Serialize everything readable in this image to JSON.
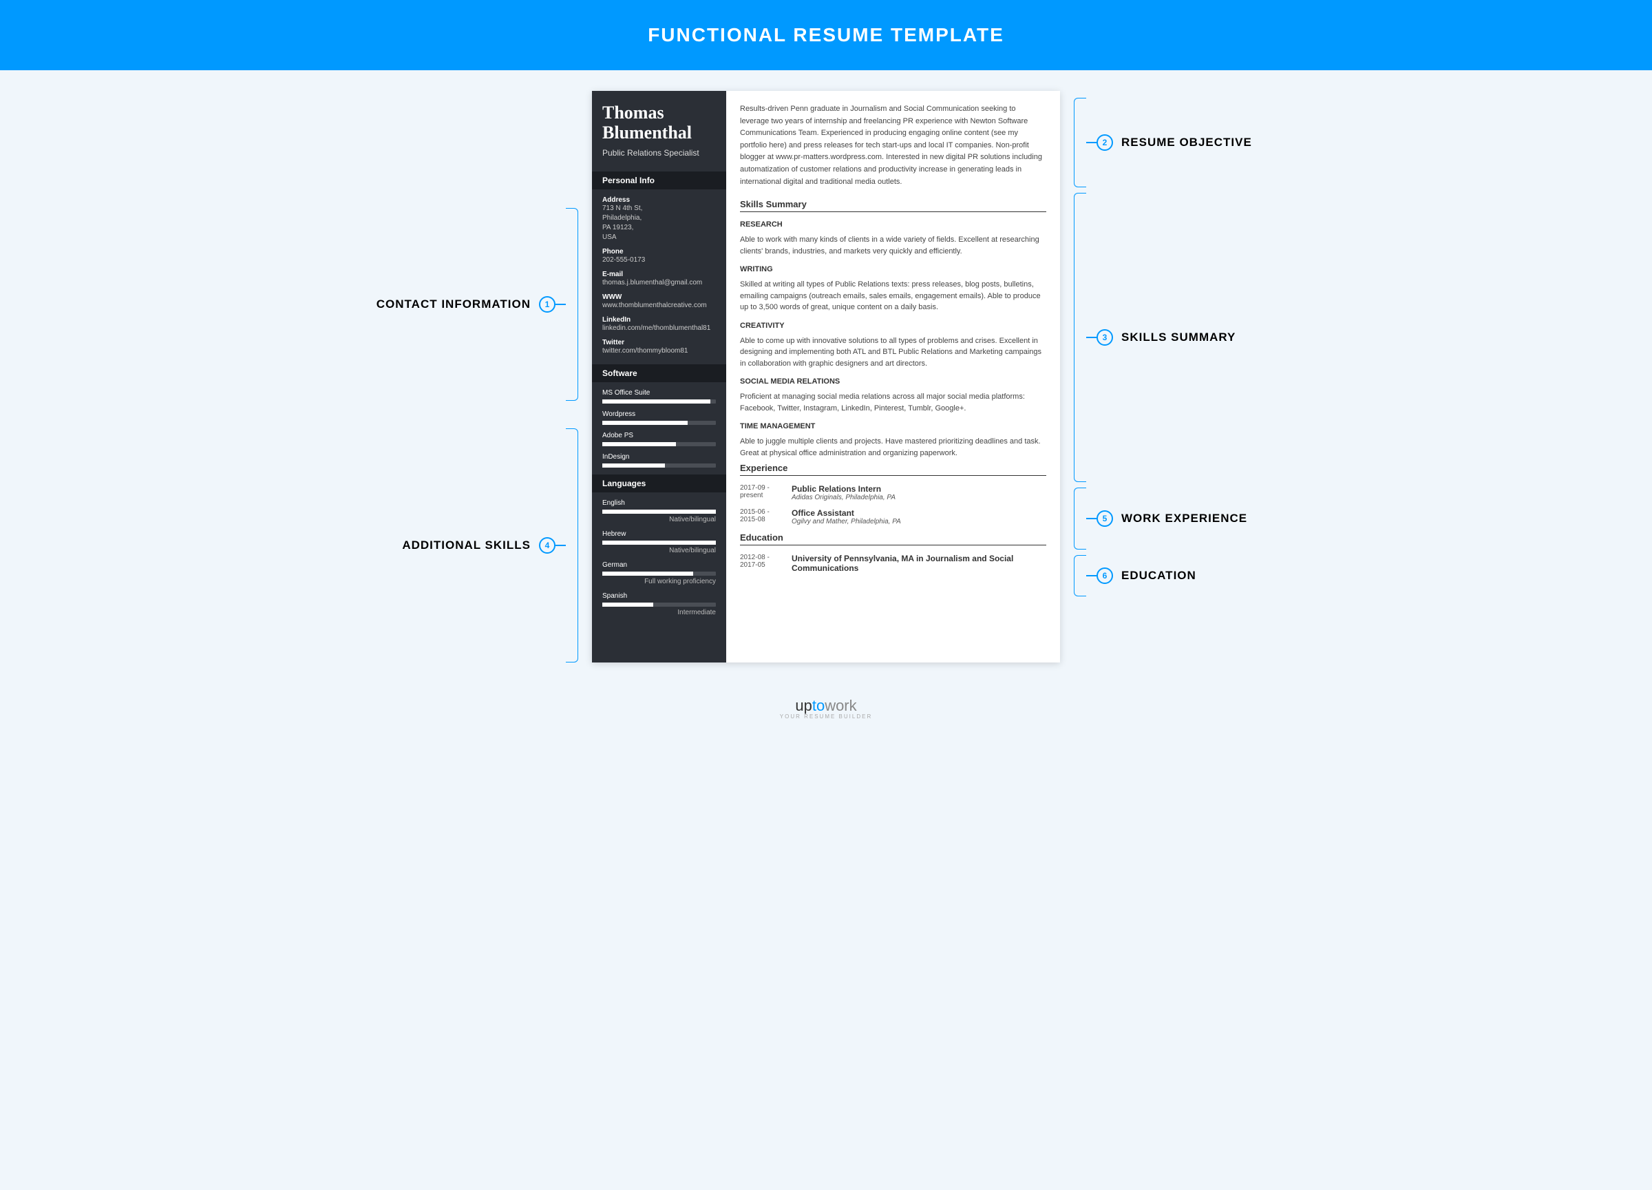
{
  "header": {
    "title": "FUNCTIONAL RESUME TEMPLATE"
  },
  "callouts": {
    "left": [
      {
        "num": "1",
        "label": "CONTACT INFORMATION"
      },
      {
        "num": "4",
        "label": "ADDITIONAL SKILLS"
      }
    ],
    "right": [
      {
        "num": "2",
        "label": "RESUME OBJECTIVE"
      },
      {
        "num": "3",
        "label": "SKILLS SUMMARY"
      },
      {
        "num": "5",
        "label": "WORK EXPERIENCE"
      },
      {
        "num": "6",
        "label": "EDUCATION"
      }
    ]
  },
  "resume": {
    "name": "Thomas Blumenthal",
    "title": "Public Relations Specialist",
    "sections": {
      "personal": "Personal Info",
      "software": "Software",
      "languages": "Languages",
      "skills": "Skills Summary",
      "experience": "Experience",
      "education": "Education"
    },
    "contact": {
      "address_label": "Address",
      "address": "713 N 4th St,\nPhiladelphia,\nPA 19123,\nUSA",
      "phone_label": "Phone",
      "phone": "202-555-0173",
      "email_label": "E-mail",
      "email": "thomas.j.blumenthal@gmail.com",
      "www_label": "WWW",
      "www": "www.thomblumenthalcreative.com",
      "linkedin_label": "LinkedIn",
      "linkedin": "linkedin.com/me/thomblumenthal81",
      "twitter_label": "Twitter",
      "twitter": "twitter.com/thommybloom81"
    },
    "software": [
      {
        "name": "MS Office Suite",
        "pct": 95,
        "level": ""
      },
      {
        "name": "Wordpress",
        "pct": 75,
        "level": ""
      },
      {
        "name": "Adobe PS",
        "pct": 65,
        "level": ""
      },
      {
        "name": "InDesign",
        "pct": 55,
        "level": ""
      }
    ],
    "languages": [
      {
        "name": "English",
        "pct": 100,
        "level": "Native/bilingual"
      },
      {
        "name": "Hebrew",
        "pct": 100,
        "level": "Native/bilingual"
      },
      {
        "name": "German",
        "pct": 80,
        "level": "Full working proficiency"
      },
      {
        "name": "Spanish",
        "pct": 45,
        "level": "Intermediate"
      }
    ],
    "objective": "Results-driven Penn graduate in Journalism and Social Communication seeking to leverage two years of internship and freelancing PR experience with Newton Software Communications Team. Experienced in producing engaging online content (see my portfolio here) and press releases for tech start-ups and local IT companies. Non-profit blogger at www.pr-matters.wordpress.com. Interested in new digital PR solutions including automatization of customer relations and productivity increase in generating leads in international digital and traditional media outlets.",
    "skills": [
      {
        "head": "RESEARCH",
        "text": "Able to work with many kinds of clients in a wide variety of fields. Excellent at researching clients' brands, industries, and markets very quickly and efficiently."
      },
      {
        "head": "WRITING",
        "text": "Skilled at writing all types of Public Relations texts: press releases, blog posts, bulletins, emailing campaigns (outreach emails, sales emails, engagement emails). Able to produce up to 3,500 words of great, unique content on a daily basis."
      },
      {
        "head": "CREATIVITY",
        "text": "Able to come up with innovative solutions to all types of problems and crises. Excellent in designing and implementing both ATL and BTL Public Relations and Marketing campaings in collaboration with graphic designers and art directors."
      },
      {
        "head": "SOCIAL MEDIA RELATIONS",
        "text": "Proficient at managing social media relations across all major social media platforms: Facebook, Twitter, Instagram, LinkedIn, Pinterest, Tumblr, Google+."
      },
      {
        "head": "TIME MANAGEMENT",
        "text": "Able to juggle multiple clients and projects. Have mastered prioritizing deadlines and task. Great at physical office administration and organizing paperwork."
      }
    ],
    "experience": [
      {
        "date": "2017-09 - present",
        "title": "Public Relations Intern",
        "sub": "Adidas Originals, Philadelphia, PA"
      },
      {
        "date": "2015-06 - 2015-08",
        "title": "Office Assistant",
        "sub": "Ogilvy and Mather, Philadelphia, PA"
      }
    ],
    "education": [
      {
        "date": "2012-08 - 2017-05",
        "title": "University of Pennsylvania, MA in Journalism and Social Communications"
      }
    ]
  },
  "footer": {
    "brand_up": "up",
    "brand_to": "to",
    "brand_work": "work",
    "tag": "YOUR RESUME BUILDER"
  }
}
